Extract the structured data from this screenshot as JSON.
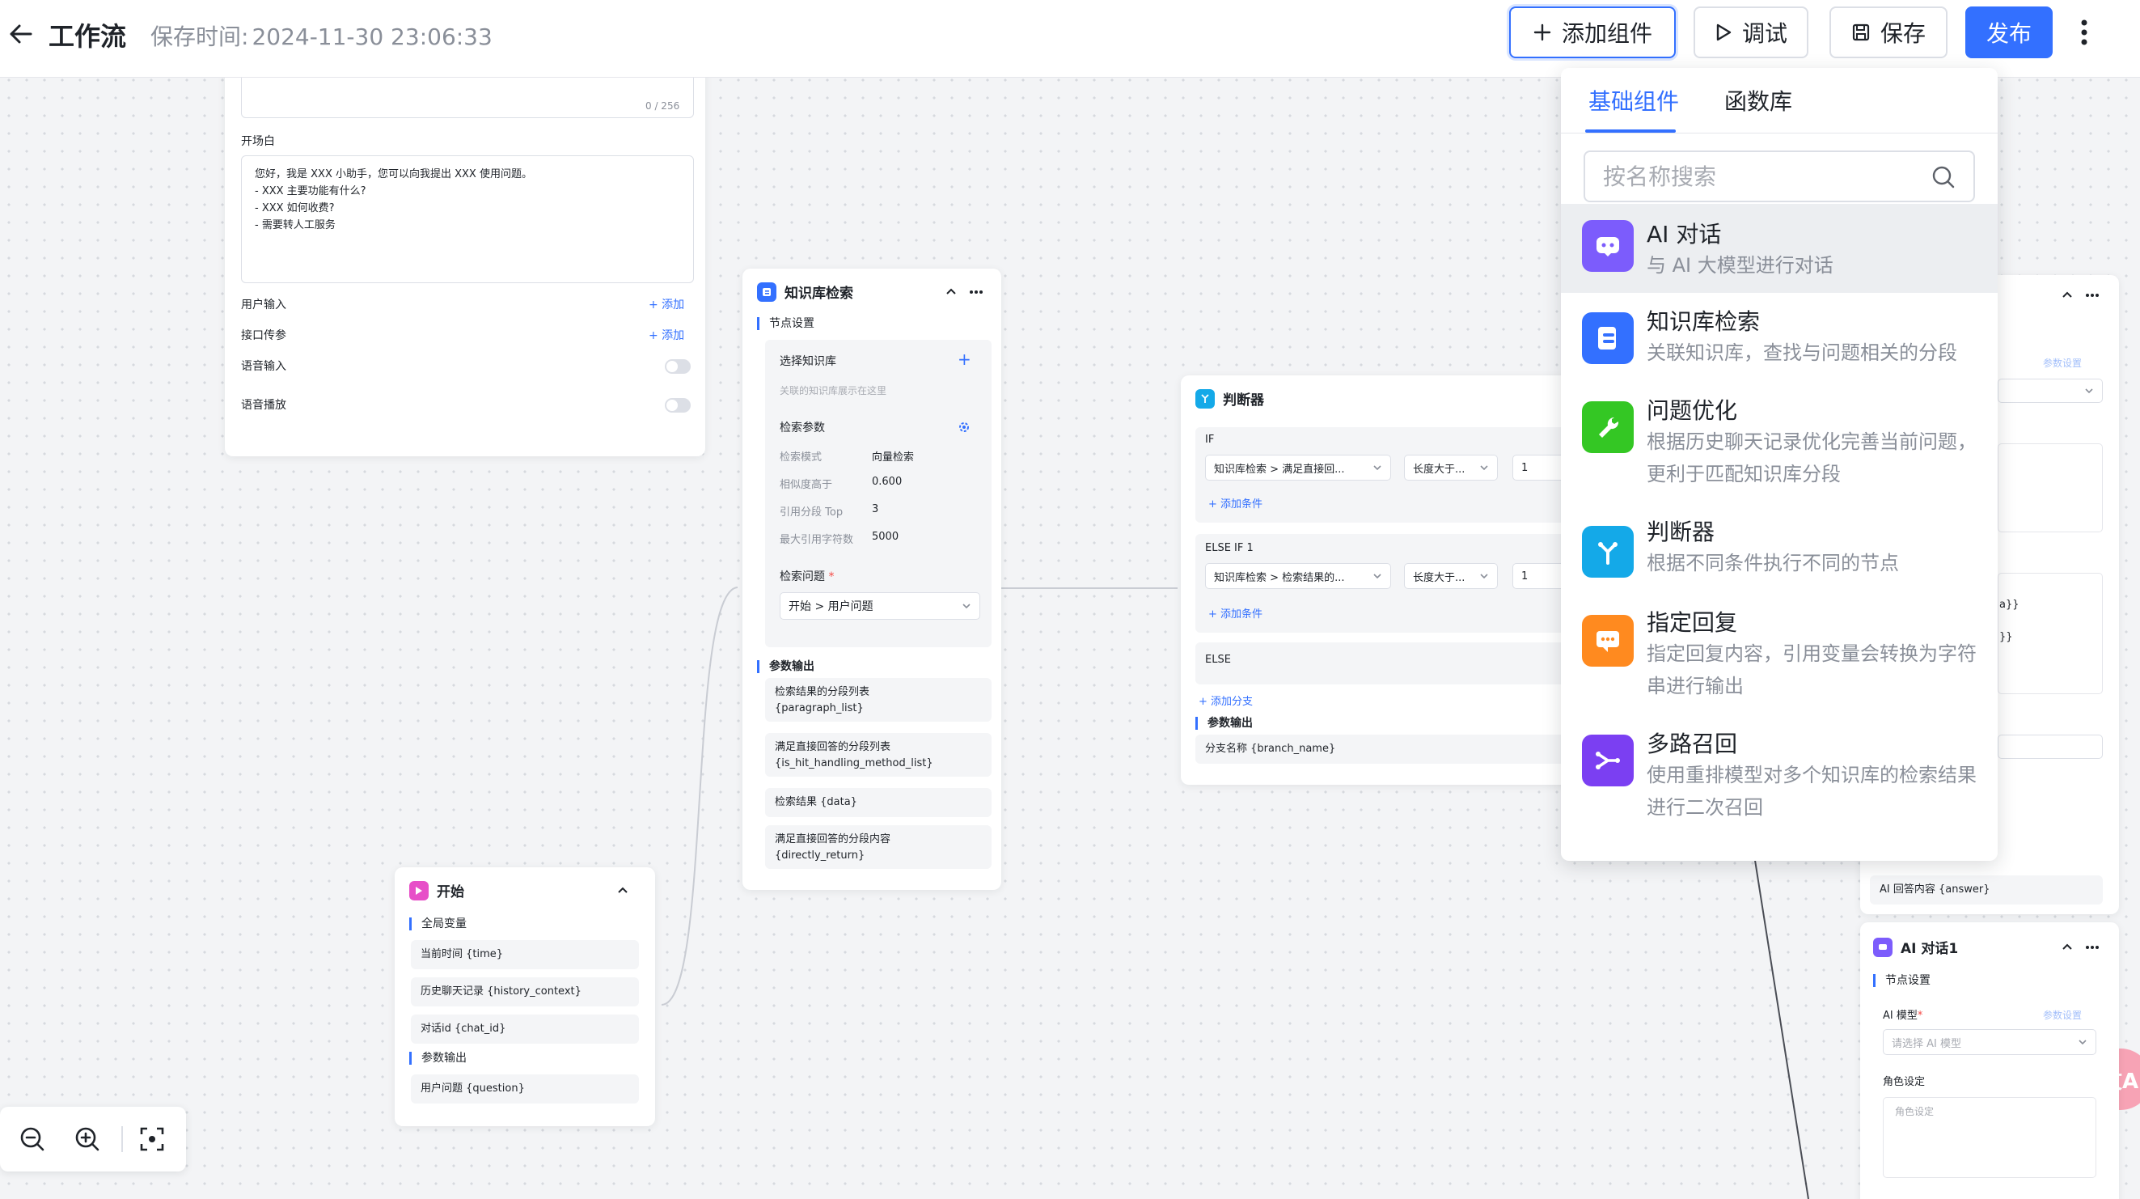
{
  "header": {
    "title": "工作流",
    "save_time_label": "保存时间:",
    "save_time_value": "2024-11-30 23:06:33",
    "add_component": "添加组件",
    "debug": "调试",
    "save": "保存",
    "publish": "发布"
  },
  "colors": {
    "primary": "#3370ff",
    "ai_chat": "#7c5cfc",
    "knowledge": "#3370ff",
    "optimize": "#34c724",
    "judge": "#14a9e8",
    "reply": "#ff8a1f",
    "multi_recall": "#7b3ff2",
    "start": "#e74fc8"
  },
  "panel": {
    "tabs": [
      "基础组件",
      "函数库"
    ],
    "search_placeholder": "按名称搜索",
    "components": [
      {
        "name": "AI 对话",
        "desc": "与 AI 大模型进行对话",
        "icon": "ai-chat-icon"
      },
      {
        "name": "知识库检索",
        "desc": "关联知识库，查找与问题相关的分段",
        "icon": "knowledge-search-icon"
      },
      {
        "name": "问题优化",
        "desc": "根据历史聊天记录优化完善当前问题，更利于匹配知识库分段",
        "icon": "wrench-icon"
      },
      {
        "name": "判断器",
        "desc": "根据不同条件执行不同的节点",
        "icon": "branch-icon"
      },
      {
        "name": "指定回复",
        "desc": "指定回复内容，引用变量会转换为字符串进行输出",
        "icon": "reply-icon"
      },
      {
        "name": "多路召回",
        "desc": "使用重排模型对多个知识库的检索结果进行二次召回",
        "icon": "multi-recall-icon"
      }
    ]
  },
  "base_node": {
    "counter": "0 / 256",
    "prologue_label": "开场白",
    "prologue_lines": [
      "您好，我是 XXX 小助手，您可以向我提出 XXX 使用问题。",
      "- XXX 主要功能有什么?",
      "- XXX 如何收费?",
      "- 需要转人工服务"
    ],
    "user_input": "用户输入",
    "api_params": "接口传参",
    "add": "+ 添加",
    "voice_input": "语音输入",
    "voice_play": "语音播放"
  },
  "knowledge_node": {
    "title": "知识库检索",
    "node_settings": "节点设置",
    "select_kb": "选择知识库",
    "kb_hint": "关联的知识库展示在这里",
    "search_params": "检索参数",
    "params": [
      {
        "k": "检索模式",
        "v": "向量检索"
      },
      {
        "k": "相似度高于",
        "v": "0.600"
      },
      {
        "k": "引用分段 Top",
        "v": "3"
      },
      {
        "k": "最大引用字符数",
        "v": "5000"
      }
    ],
    "question_label": "检索问题",
    "question_value": "开始 > 用户问题",
    "output_label": "参数输出",
    "outputs": [
      [
        "检索结果的分段列表",
        "{paragraph_list}"
      ],
      [
        "满足直接回答的分段列表",
        "{is_hit_handling_method_list}"
      ],
      [
        "检索结果 {data}"
      ],
      [
        "满足直接回答的分段内容",
        "{directly_return}"
      ]
    ]
  },
  "judge_node": {
    "title": "判断器",
    "if_label": "IF",
    "if_select": "知识库检索 > 满足直接回...",
    "op_select": "长度大于...",
    "value": "1",
    "add_condition": "+ 添加条件",
    "elseif_label": "ELSE IF 1",
    "elseif_select": "知识库检索 > 检索结果的...",
    "else_label": "ELSE",
    "add_branch": "+ 添加分支",
    "output_label": "参数输出",
    "output_value": "分支名称 {branch_name}"
  },
  "start_node": {
    "title": "开始",
    "globals": "全局变量",
    "vars": [
      "当前时间 {time}",
      "历史聊天记录 {history_context}",
      "对话id {chat_id}"
    ],
    "output_label": "参数输出",
    "output_value": "用户问题 {question}"
  },
  "right_partial": {
    "params_setting": "参数设置",
    "text_a": "a}}",
    "text_b": "}}",
    "answer_output": "AI 回答内容 {answer}"
  },
  "ai_node": {
    "title": "AI 对话1",
    "node_settings": "节点设置",
    "model_label": "AI 模型",
    "params_setting": "参数设置",
    "model_placeholder": "请选择 AI 模型",
    "role_label": "角色设定",
    "role_placeholder": "角色设定"
  },
  "translate_label": "文A"
}
